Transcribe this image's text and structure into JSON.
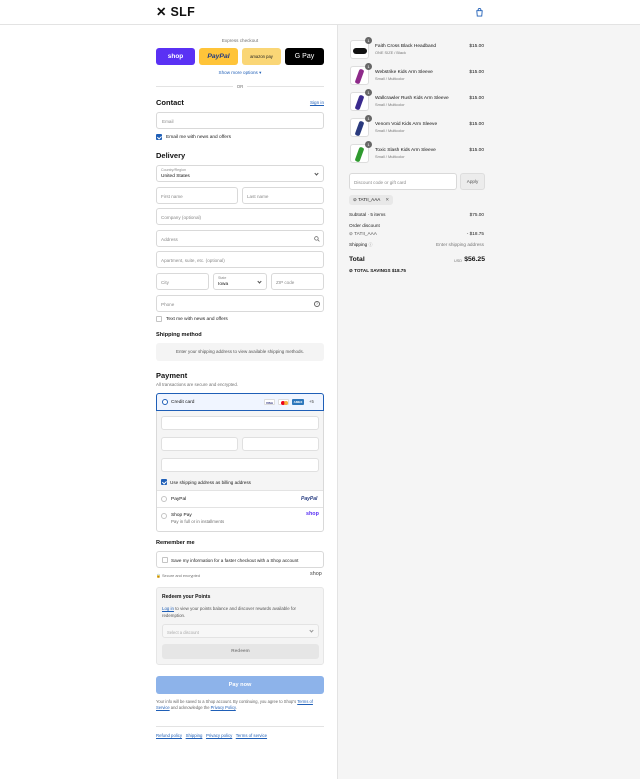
{
  "brand": {
    "logo": "✕ SLF"
  },
  "express": {
    "title": "Express checkout",
    "shop": "shop",
    "paypal": "PayPal",
    "amazon": "amazon pay",
    "gpay": "G Pay",
    "more": "Show more options",
    "or": "OR"
  },
  "contact": {
    "heading": "Contact",
    "sign_in": "Sign in",
    "email_placeholder": "Email",
    "news_label": "Email me with news and offers"
  },
  "delivery": {
    "heading": "Delivery",
    "country_label": "Country/Region",
    "country": "United States",
    "first_name": "First name",
    "last_name": "Last name",
    "company": "Company (optional)",
    "address": "Address",
    "apartment": "Apartment, suite, etc. (optional)",
    "city": "City",
    "state_label": "State",
    "state": "Iowa",
    "zip": "ZIP code",
    "phone": "Phone",
    "text_label": "Text me with news and offers"
  },
  "shipping": {
    "heading": "Shipping method",
    "notice": "Enter your shipping address to view available shipping methods."
  },
  "payment": {
    "heading": "Payment",
    "subtitle": "All transactions are secure and encrypted.",
    "credit_card": "Credit card",
    "card_brands": [
      "VISA",
      "MC",
      "AMEX"
    ],
    "more_brands": "+5",
    "billing_same": "Use shipping address as billing address",
    "paypal": "PayPal",
    "paypal_logo": "PayPal",
    "shop_pay": "Shop Pay",
    "shop_pay_sub": "Pay in full or in installments",
    "shop_logo": "shop"
  },
  "remember": {
    "heading": "Remember me",
    "save_label": "Save my information for a faster checkout with a Shop account",
    "secure": "Secure and encrypted",
    "shop_logo": "shop"
  },
  "points": {
    "heading": "Redeem your Points",
    "login": "Log in",
    "text_rest": " to view your points balance and discover rewards available for redemption.",
    "select_placeholder": "Select a discount",
    "redeem": "Redeem"
  },
  "pay_now": "Pay now",
  "legal": {
    "line1": "Your info will be saved to a Shop account. By continuing, you agree to Shop's",
    "terms": "Terms of Service",
    "and": " and acknowledge the ",
    "privacy": "Privacy Policy",
    "end": "."
  },
  "footer": {
    "links": [
      "Refund policy",
      "Shipping",
      "Privacy policy",
      "Terms of service"
    ]
  },
  "items": [
    {
      "name": "Faith Cross Black Headband",
      "variant": "ONE SIZE / Black",
      "price": "$15.00",
      "qty": "1",
      "color": "#111111"
    },
    {
      "name": "Webstrike Kids Arm Sleeve",
      "variant": "Small / Multicolor",
      "price": "$15.00",
      "qty": "1",
      "color": "#8e2a8a"
    },
    {
      "name": "Wallcrawler Rush Kids Arm Sleeve",
      "variant": "Small / Multicolor",
      "price": "$15.00",
      "qty": "1",
      "color": "#3a2a8e"
    },
    {
      "name": "Venom Void Kids Arm Sleeve",
      "variant": "Small / Multicolor",
      "price": "$15.00",
      "qty": "1",
      "color": "#2a3a7e"
    },
    {
      "name": "Toxic Slash Kids Arm Sleeve",
      "variant": "Small / Multicolor",
      "price": "$15.00",
      "qty": "1",
      "color": "#2f9a2f"
    }
  ],
  "discount": {
    "placeholder": "Discount code or gift card",
    "apply": "Apply",
    "tag": "TATII_AAA"
  },
  "summary": {
    "subtotal_label": "Subtotal · 5 items",
    "subtotal": "$75.00",
    "order_discount": "Order discount",
    "code": "TATII_AAA",
    "discount_value": "- $18.75",
    "shipping_label": "Shipping",
    "shipping_value": "Enter shipping address",
    "total_label": "Total",
    "currency": "USD",
    "total": "$56.25",
    "savings_label": "TOTAL SAVINGS",
    "savings": "$18.75"
  }
}
